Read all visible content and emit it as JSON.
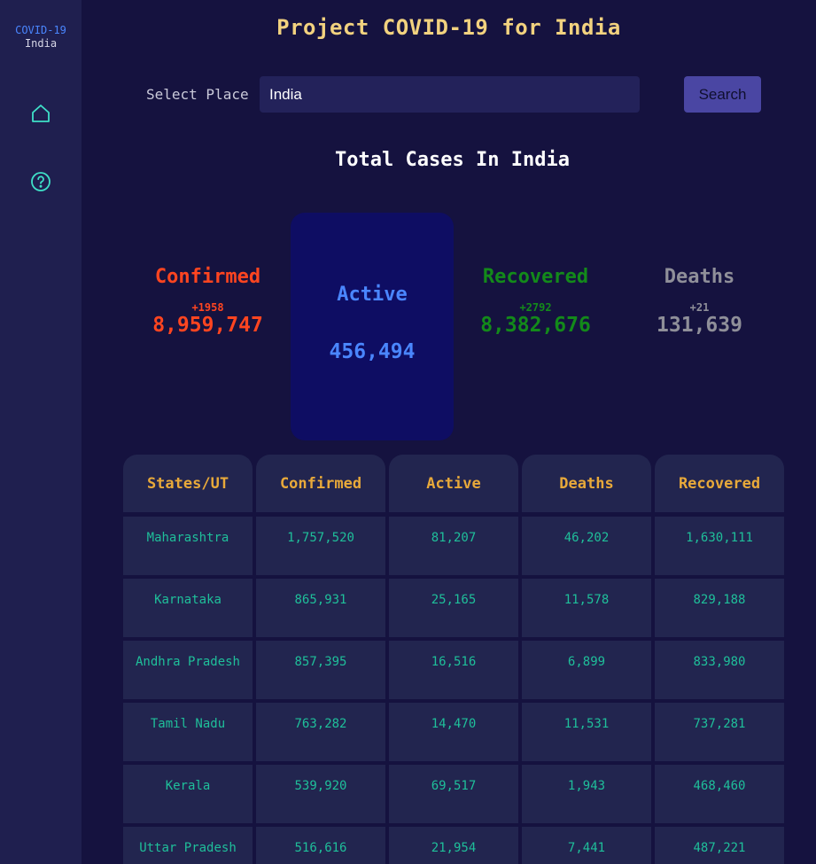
{
  "brand": {
    "line1": "COVID-19",
    "line2": "India"
  },
  "nav": {
    "home_icon": "home-icon",
    "help_icon": "help-circle-icon"
  },
  "title": "Project COVID-19 for India",
  "search": {
    "label": "Select Place",
    "value": "India",
    "button": "Search"
  },
  "section_title": "Total Cases In India",
  "stats": {
    "confirmed": {
      "label": "Confirmed",
      "delta": "+1958",
      "value": "8,959,747"
    },
    "active": {
      "label": "Active",
      "value": "456,494"
    },
    "recovered": {
      "label": "Recovered",
      "delta": "+2792",
      "value": "8,382,676"
    },
    "deaths": {
      "label": "Deaths",
      "delta": "+21",
      "value": "131,639"
    }
  },
  "colors": {
    "confirmed": "#ff4520",
    "active": "#4a86ff",
    "recovered": "#138a1a",
    "deaths": "#8f8f99",
    "title": "#f2d27f",
    "table_header": "#e8a93a",
    "table_cell": "#1fbf9a"
  },
  "table": {
    "headers": [
      "States/UT",
      "Confirmed",
      "Active",
      "Deaths",
      "Recovered"
    ],
    "rows": [
      [
        "Maharashtra",
        "1,757,520",
        "81,207",
        "46,202",
        "1,630,111"
      ],
      [
        "Karnataka",
        "865,931",
        "25,165",
        "11,578",
        "829,188"
      ],
      [
        "Andhra Pradesh",
        "857,395",
        "16,516",
        "6,899",
        "833,980"
      ],
      [
        "Tamil Nadu",
        "763,282",
        "14,470",
        "11,531",
        "737,281"
      ],
      [
        "Kerala",
        "539,920",
        "69,517",
        "1,943",
        "468,460"
      ],
      [
        "Uttar Pradesh",
        "516,616",
        "21,954",
        "7,441",
        "487,221"
      ]
    ]
  }
}
